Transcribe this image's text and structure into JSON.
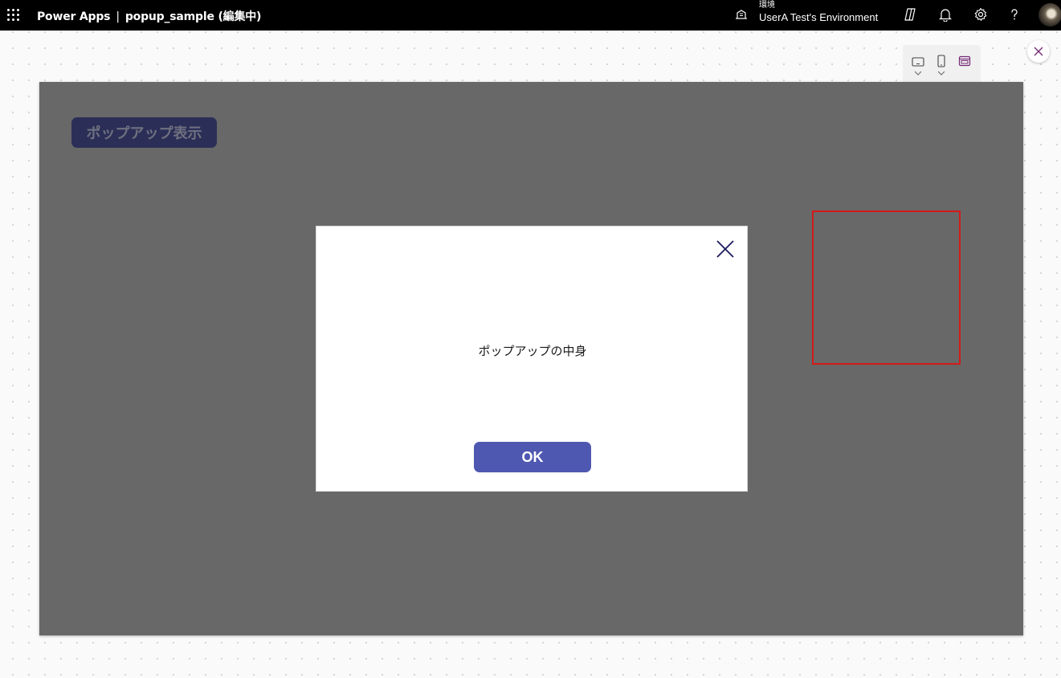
{
  "topbar": {
    "app_name": "Power Apps",
    "separator": "|",
    "doc_title": "popup_sample (編集中)",
    "environment_label": "環境",
    "environment_name": "UserA Test's Environment"
  },
  "toolbar": {
    "icons": [
      "tablet-icon",
      "phone-icon",
      "web-icon"
    ],
    "active_icon": "web-icon"
  },
  "canvas": {
    "popup_button_label": "ポップアップ表示",
    "popup": {
      "content_text": "ポップアップの中身",
      "ok_label": "OK"
    }
  },
  "colors": {
    "accent": "#742774",
    "popup_button_bg": "#2b2f57",
    "ok_button_bg": "#4f58b0",
    "overlay": "#686868",
    "highlight_border": "#d41a1a"
  }
}
